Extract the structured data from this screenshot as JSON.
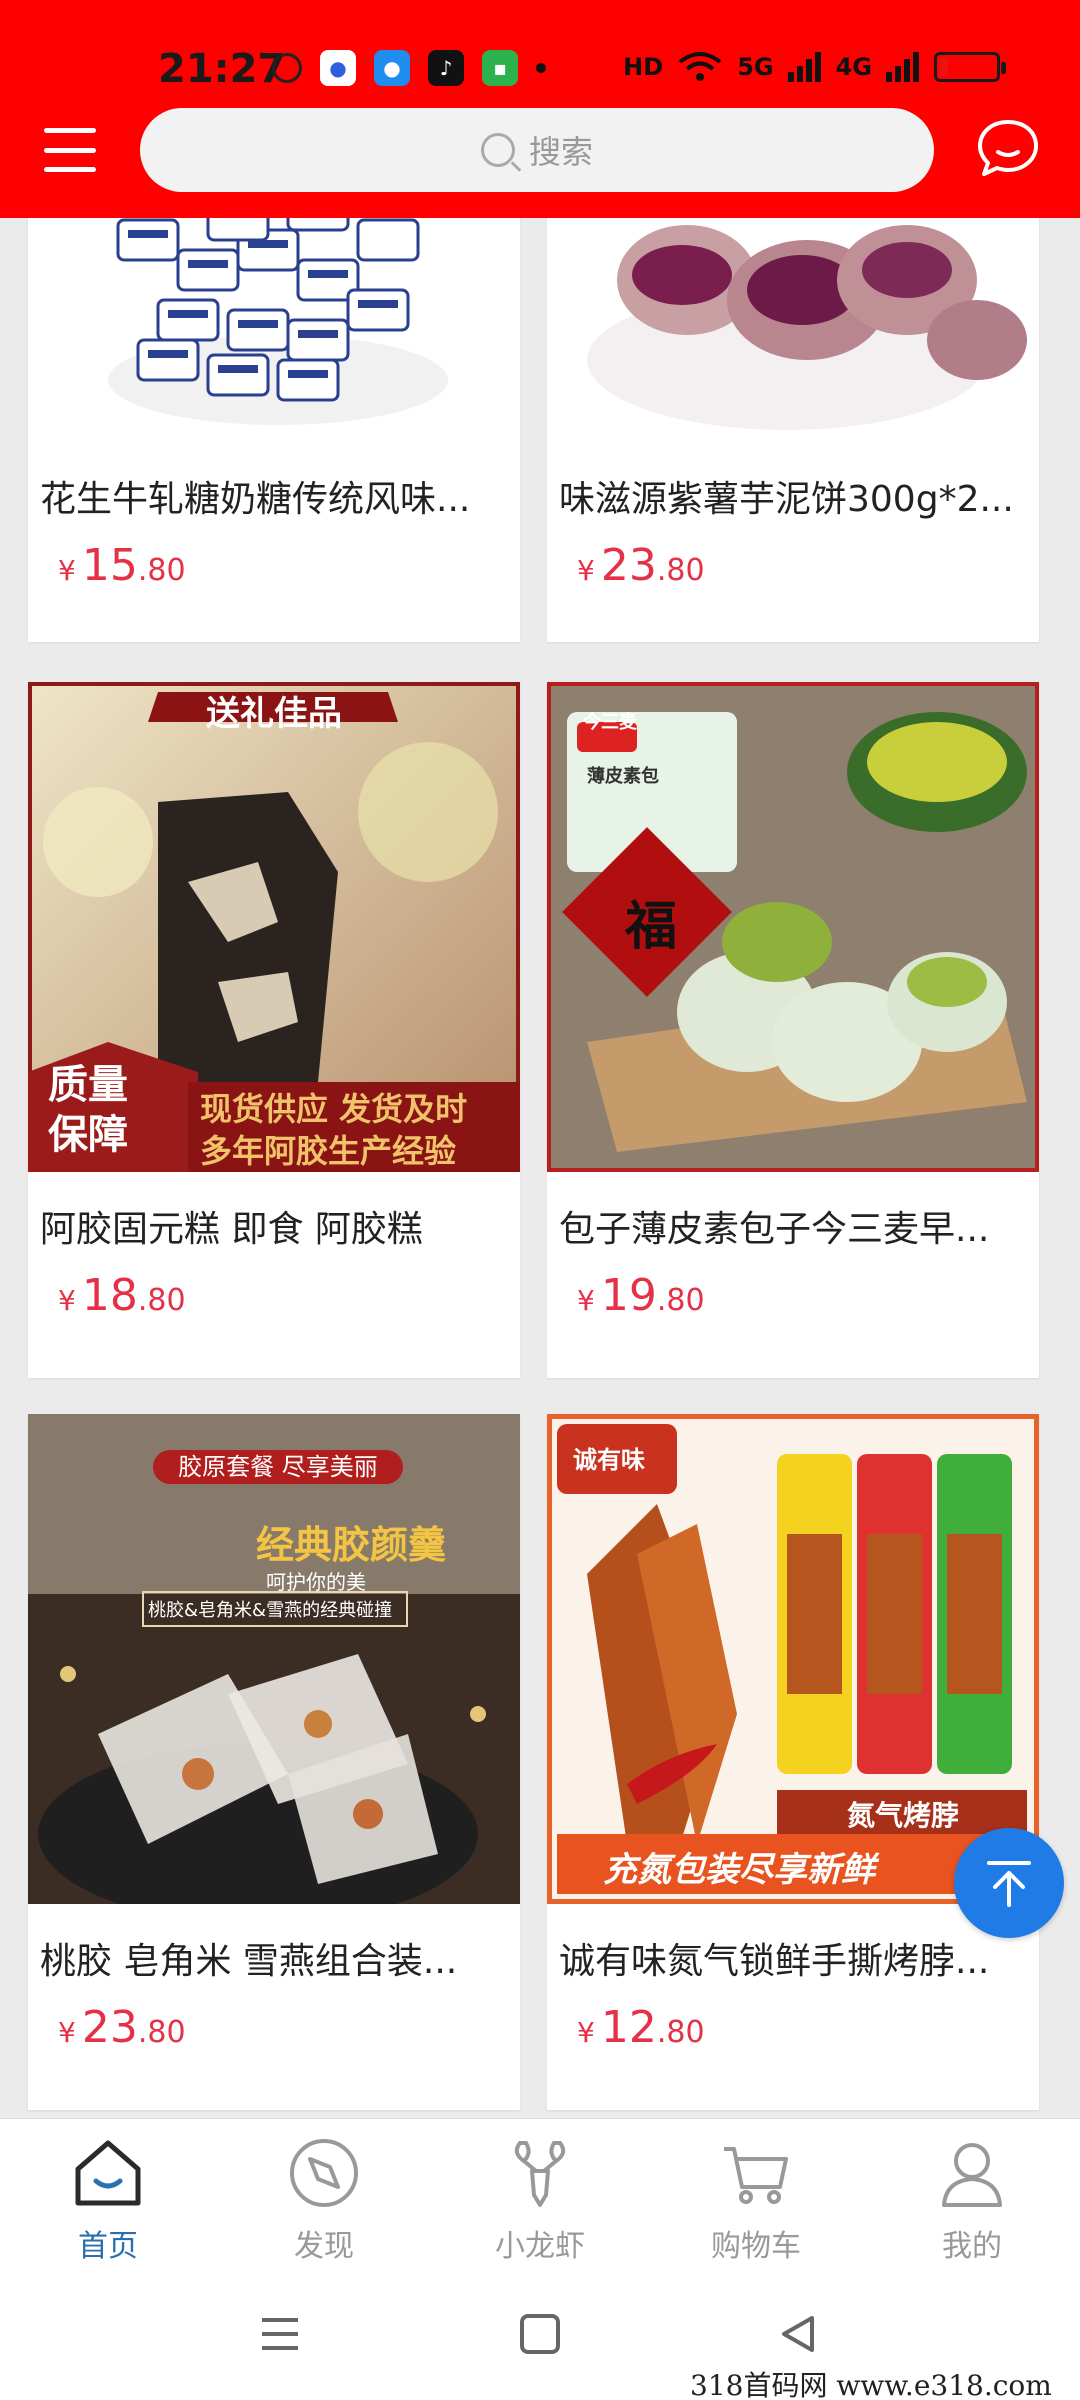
{
  "status_bar": {
    "time": "21:27",
    "indicators": [
      "HD",
      "5G",
      "4G"
    ],
    "battery_level": 0.1
  },
  "header": {
    "search_placeholder": "搜索",
    "icons": [
      "menu-icon",
      "search-icon",
      "chat-bubble-icon"
    ],
    "background_color": "#fe0000"
  },
  "products": [
    {
      "title": "花生牛轧糖奶糖传统风味...",
      "currency": "¥",
      "price_int": "15",
      "price_dec": ".80"
    },
    {
      "title": "味滋源紫薯芋泥饼300g*2...",
      "currency": "¥",
      "price_int": "23",
      "price_dec": ".80"
    },
    {
      "title": "阿胶固元糕 即食 阿胶糕",
      "currency": "¥",
      "price_int": "18",
      "price_dec": ".80",
      "image_text": {
        "banner": "送礼佳品",
        "badge_top": "质量",
        "badge_bottom": "保障",
        "line1": "现货供应 发货及时",
        "line2": "多年阿胶生产经验"
      }
    },
    {
      "title": "包子薄皮素包子今三麦早...",
      "currency": "¥",
      "price_int": "19",
      "price_dec": ".80",
      "image_text": {
        "brand": "今三麦",
        "pack": "薄皮素包",
        "fu": "福"
      }
    },
    {
      "title": "桃胶 皂角米 雪燕组合装...",
      "currency": "¥",
      "price_int": "23",
      "price_dec": ".80",
      "image_text": {
        "pill": "胶原套餐 尽享美丽",
        "headline": "经典胶颜羹",
        "sub1": "呵护你的美",
        "sub2": "桃胶&皂角米&雪燕的经典碰撞"
      }
    },
    {
      "title": "诚有味氮气锁鲜手撕烤脖...",
      "currency": "¥",
      "price_int": "12",
      "price_dec": ".80",
      "image_text": {
        "brand": "诚有味",
        "tag": "氮气烤脖",
        "banner": "充氮包装尽享新鲜"
      }
    }
  ],
  "tabbar": {
    "items": [
      {
        "label": "首页",
        "icon": "home-icon",
        "active": true
      },
      {
        "label": "发现",
        "icon": "compass-icon",
        "active": false
      },
      {
        "label": "小龙虾",
        "icon": "crayfish-icon",
        "active": false
      },
      {
        "label": "购物车",
        "icon": "cart-icon",
        "active": false
      },
      {
        "label": "我的",
        "icon": "user-icon",
        "active": false
      }
    ],
    "active_color": "#2a6fb0"
  },
  "back_to_top": {
    "icon": "arrow-up-icon",
    "color": "#1f7be6"
  },
  "system_nav": {
    "icons": [
      "recents-icon",
      "home-square-icon",
      "back-icon"
    ]
  },
  "watermark": "318首码网   www.e318.com"
}
